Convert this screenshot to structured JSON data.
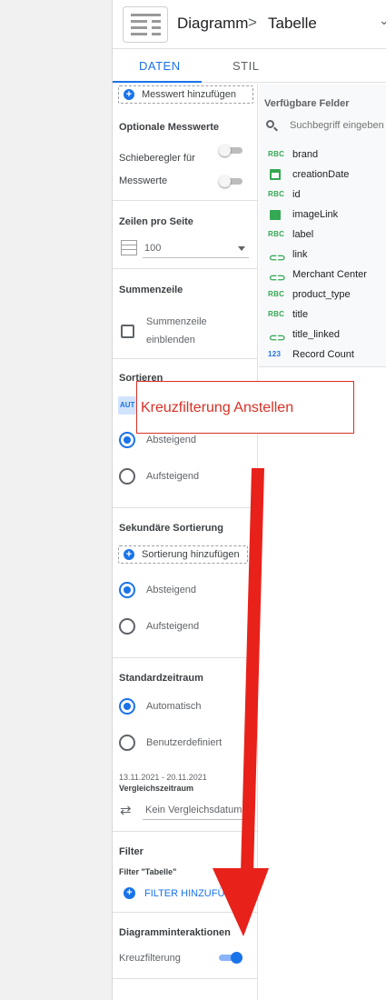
{
  "header": {
    "breadcrumb_root": "Diagramm",
    "breadcrumb_sep": ">",
    "breadcrumb_current": "Tabelle",
    "expand_glyph": "⌄"
  },
  "tabs": [
    {
      "label": "DATEN",
      "active": true
    },
    {
      "label": "STIL",
      "active": false
    }
  ],
  "data_panel": {
    "add_metric": "Messwert hinzufügen",
    "optional_metrics": {
      "title": "Optionale Messwerte",
      "slider_label": "Schieberegler für",
      "metrics_label": "Messwerte",
      "slider_on": false,
      "metrics_on": false
    },
    "rows_per_page": {
      "title": "Zeilen pro Seite",
      "value": "100"
    },
    "summary_row": {
      "title": "Summenzeile",
      "checkbox_label_1": "Summenzeile",
      "checkbox_label_2": "einblenden",
      "checked": false
    },
    "sort": {
      "title": "Sortieren",
      "metric_chip": "AUT",
      "options": [
        {
          "label": "Absteigend",
          "selected": true
        },
        {
          "label": "Aufsteigend",
          "selected": false
        }
      ]
    },
    "secondary_sort": {
      "title": "Sekundäre Sortierung",
      "add_label": "Sortierung hinzufügen",
      "options": [
        {
          "label": "Absteigend",
          "selected": true
        },
        {
          "label": "Aufsteigend",
          "selected": false
        }
      ]
    },
    "default_date_range": {
      "title": "Standardzeitraum",
      "options": [
        {
          "label": "Automatisch",
          "selected": true
        },
        {
          "label": "Benutzerdefiniert",
          "selected": false
        }
      ],
      "date_range": "13.11.2021 - 20.11.2021",
      "comparison_label": "Vergleichszeitraum",
      "comparison_value": "Kein Vergleichsdatum"
    },
    "filter": {
      "title": "Filter",
      "subtitle": "Filter \"Tabelle\"",
      "add_label": "FILTER HINZUFÜGEN"
    },
    "interactions": {
      "title": "Diagramminteraktionen",
      "cross_filter_label": "Kreuzfilterung",
      "cross_filter_on": true
    }
  },
  "available_fields": {
    "title": "Verfügbare Felder",
    "search_placeholder": "Suchbegriff eingeben",
    "fields": [
      {
        "type": "RBC",
        "name": "brand",
        "icon": "text-type-icon"
      },
      {
        "type": "date",
        "name": "creationDate",
        "icon": "calendar-icon"
      },
      {
        "type": "RBC",
        "name": "id",
        "icon": "text-type-icon"
      },
      {
        "type": "image",
        "name": "imageLink",
        "icon": "image-icon"
      },
      {
        "type": "RBC",
        "name": "label",
        "icon": "text-type-icon"
      },
      {
        "type": "link",
        "name": "link",
        "icon": "link-icon"
      },
      {
        "type": "link",
        "name": "Merchant Center",
        "icon": "link-icon"
      },
      {
        "type": "RBC",
        "name": "product_type",
        "icon": "text-type-icon"
      },
      {
        "type": "RBC",
        "name": "title",
        "icon": "text-type-icon"
      },
      {
        "type": "link",
        "name": "title_linked",
        "icon": "link-icon"
      },
      {
        "type": "123",
        "name": "Record Count",
        "icon": "number-type-icon"
      }
    ]
  },
  "annotation": {
    "text": "Kreuzfilterung Anstellen",
    "color": "#d93025"
  },
  "colors": {
    "accent": "#1a73e8",
    "annotation": "#d93025",
    "field_text_type": "#34a853"
  }
}
